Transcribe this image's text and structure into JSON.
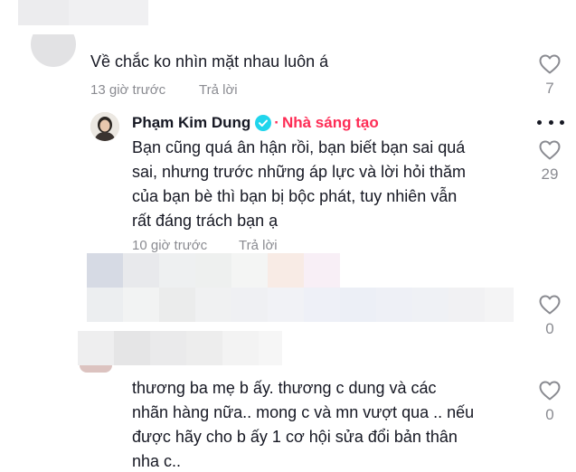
{
  "comments": [
    {
      "text": "Về chắc ko nhìn mặt nhau luôn á",
      "time": "13 giờ trước",
      "reply_label": "Trả lời",
      "likes": "7"
    }
  ],
  "reply": {
    "author": "Phạm Kim Dung",
    "verified": true,
    "separator": "·",
    "creator_tag": "Nhà sáng tạo",
    "lines": [
      "Bạn cũng quá ân hận rồi, bạn biết bạn sai quá",
      "sai, nhưng trước những áp lực và lời hỏi thăm",
      "của bạn bè thì bạn bị bộc phát, tuy nhiên vẫn",
      "rất đáng trách bạn ạ"
    ],
    "time": "10 giờ trước",
    "reply_label": "Trả lời",
    "likes": "29"
  },
  "blurred_comment": {
    "likes": "0"
  },
  "last_comment": {
    "lines": [
      "thương ba mẹ b ấy. thương c dung và các",
      "nhãn hàng nữa.. mong c và mn vượt qua .. nếu",
      "được hãy cho b ấy 1 cơ hội sửa đổi bản thân",
      "nha c.."
    ],
    "likes": "0"
  },
  "icons": {
    "like": "heart-outline-icon",
    "verified": "verified-check-icon",
    "more": "more-dots-icon"
  },
  "colors": {
    "text": "#161823",
    "muted": "#8a8b91",
    "creator": "#fe2c55",
    "verified": "#20d5ec"
  }
}
